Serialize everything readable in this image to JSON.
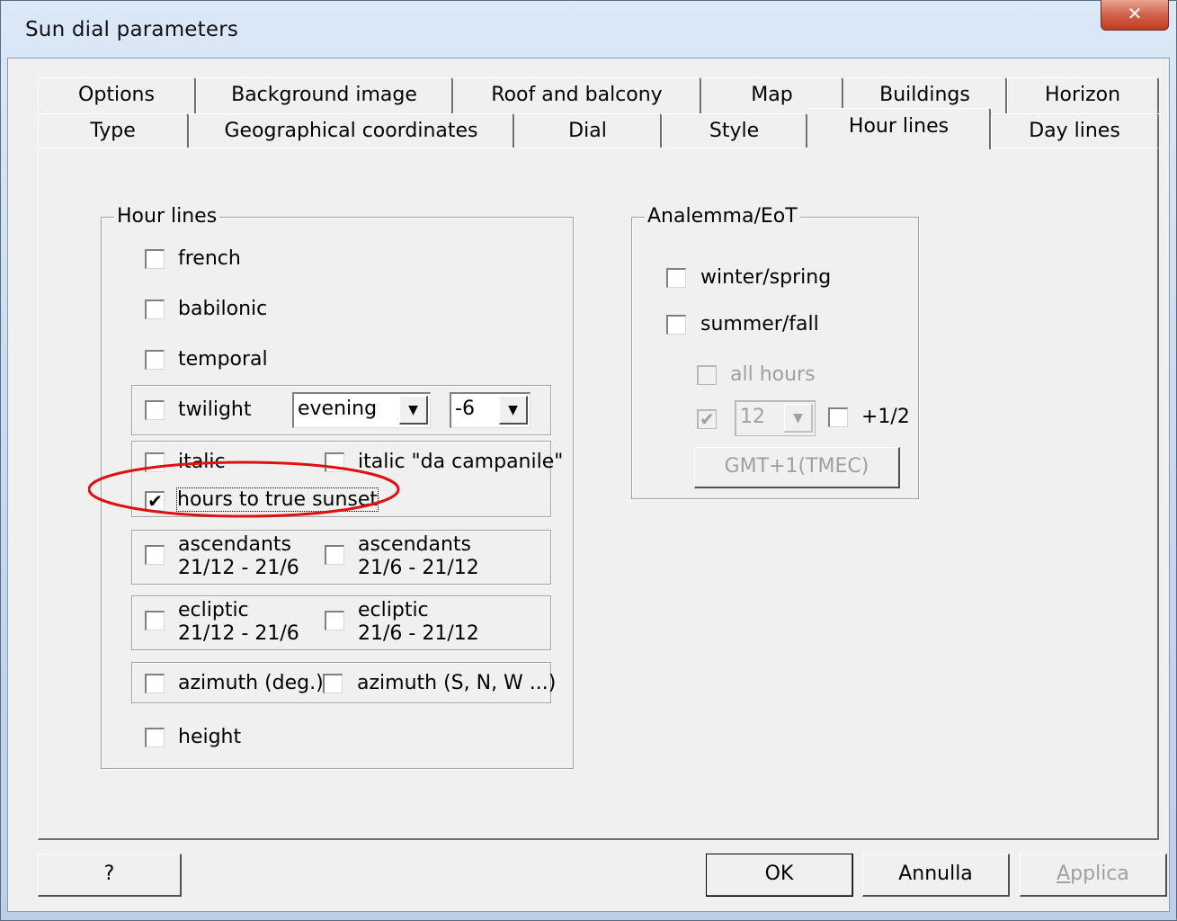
{
  "window": {
    "title": "Sun dial parameters",
    "close_glyph": "✕",
    "highlight_color": "#e01010"
  },
  "tabs": {
    "row1": [
      "Options",
      "Background image",
      "Roof and balcony",
      "Map",
      "Buildings",
      "Horizon"
    ],
    "row2": [
      "Type",
      "Geographical coordinates",
      "Dial",
      "Style",
      "Hour lines",
      "Day lines"
    ],
    "active": "Hour lines"
  },
  "hour_lines": {
    "title": "Hour lines",
    "french": {
      "label": "french",
      "checked": false
    },
    "babilonic": {
      "label": "babilonic",
      "checked": false
    },
    "temporal": {
      "label": "temporal",
      "checked": false
    },
    "twilight": {
      "label": "twilight",
      "checked": false,
      "mode": "evening",
      "degrees": "-6"
    },
    "italic": {
      "label": "italic",
      "checked": false
    },
    "italic_campanile": {
      "label": "italic \"da campanile\"",
      "checked": false
    },
    "hours_to_true_sunset": {
      "label": "hours to true sunset",
      "checked": true,
      "check_glyph": "✔"
    },
    "ascendants_1": {
      "line1": "ascendants",
      "line2": "21/12 - 21/6",
      "checked": false
    },
    "ascendants_2": {
      "line1": "ascendants",
      "line2": "21/6 - 21/12",
      "checked": false
    },
    "ecliptic_1": {
      "line1": "ecliptic",
      "line2": "21/12 - 21/6",
      "checked": false
    },
    "ecliptic_2": {
      "line1": "ecliptic",
      "line2": "21/6 - 21/12",
      "checked": false
    },
    "azimuth_deg": {
      "label": "azimuth (deg.)",
      "checked": false
    },
    "azimuth_dir": {
      "label": "azimuth (S, N, W ...)",
      "checked": false
    },
    "height": {
      "label": "height",
      "checked": false
    }
  },
  "analemma": {
    "title": "Analemma/EoT",
    "winter_spring": {
      "label": "winter/spring",
      "checked": false
    },
    "summer_fall": {
      "label": "summer/fall",
      "checked": false
    },
    "all_hours": {
      "label": "all hours",
      "checked": false,
      "enabled": false
    },
    "hour_checkbox": {
      "checked": true,
      "enabled": false,
      "check_glyph": "✔"
    },
    "hour_value": "12",
    "half_hour": {
      "label": "+1/2",
      "checked": false
    },
    "timezone_button": "GMT+1(TMEC)"
  },
  "buttons": {
    "help": "?",
    "ok": "OK",
    "cancel": "Annulla",
    "apply_first": "A",
    "apply_rest": "pplica"
  },
  "icons": {
    "dropdown": "▼"
  }
}
